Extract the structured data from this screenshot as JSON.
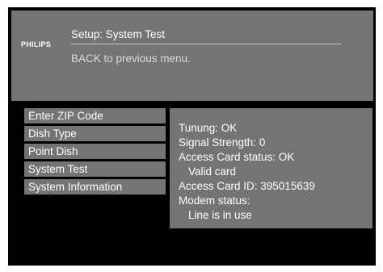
{
  "header": {
    "brand": "PHILIPS",
    "title": "Setup: System Test",
    "back_hint": "BACK to previous menu."
  },
  "menu": {
    "items": [
      {
        "label": "Enter ZIP Code"
      },
      {
        "label": "Dish Type"
      },
      {
        "label": "Point Dish"
      },
      {
        "label": "System Test"
      },
      {
        "label": "System Information"
      }
    ]
  },
  "info": {
    "lines": [
      {
        "text": "Tunung: OK"
      },
      {
        "text": "Signal Strength: 0"
      },
      {
        "text": "Access Card status: OK"
      },
      {
        "text": "Valid card"
      },
      {
        "text": "Access Card ID: 395015639"
      },
      {
        "text": "Modem status:"
      },
      {
        "text": "Line is in use"
      }
    ]
  },
  "colors": {
    "background": "#000000",
    "panel": "#747474",
    "text": "#ffffff"
  }
}
